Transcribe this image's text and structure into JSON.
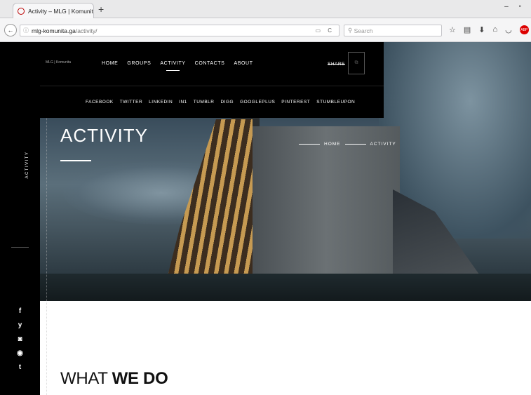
{
  "browser": {
    "tab_title": "Activity – MLG | Komunita",
    "tab_close": "×",
    "new_tab": "+",
    "window_controls": "– ▫",
    "back_button": "←",
    "info_icon": "ⓘ",
    "url_host": "mlg-komunita.ga",
    "url_path": "/activity/",
    "url_icons": "▭ C",
    "search_placeholder": "Search",
    "toolbar_icons": [
      "☆",
      "▤",
      "⬇",
      "⌂",
      "◡"
    ],
    "adblock_label": "ABP"
  },
  "site": {
    "logo_text": "MLG | Komunita",
    "menu": [
      {
        "label": "HOME"
      },
      {
        "label": "GROUPS"
      },
      {
        "label": "ACTIVITY"
      },
      {
        "label": "CONTACTS"
      },
      {
        "label": "ABOUT"
      }
    ],
    "share_label": "SHARE",
    "share_box_icon": "⧉",
    "share_links": [
      "FACEBOOK",
      "TWITTER",
      "LINKEDIN",
      "IN1",
      "TUMBLR",
      "DIGG",
      "GOOGLEPLUS",
      "PINTEREST",
      "STUMBLEUPON"
    ],
    "sidebar_label": "ACTIVITY",
    "social_icons": [
      "f",
      "y",
      "◙",
      "◉",
      "t"
    ]
  },
  "hero": {
    "title": "ACTIVITY",
    "breadcrumb": [
      "HOME",
      "ACTIVITY"
    ]
  },
  "section": {
    "heading_light": "WHAT ",
    "heading_bold": "WE DO"
  }
}
